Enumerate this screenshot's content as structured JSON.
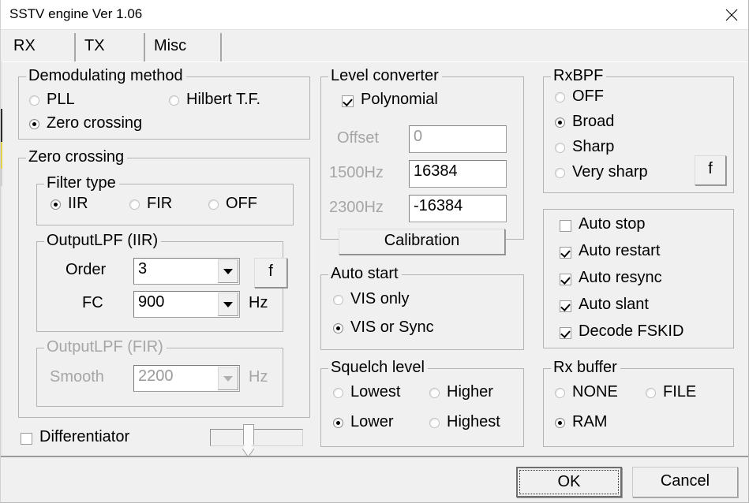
{
  "window": {
    "title": "SSTV engine Ver 1.06",
    "close_icon": "close-icon"
  },
  "tabs": [
    {
      "label": "RX",
      "selected": true
    },
    {
      "label": "TX",
      "selected": false
    },
    {
      "label": "Misc",
      "selected": false
    }
  ],
  "demodulating_method": {
    "legend": "Demodulating method",
    "options": [
      {
        "label": "PLL",
        "selected": false
      },
      {
        "label": "Hilbert T.F.",
        "selected": false
      },
      {
        "label": "Zero crossing",
        "selected": true
      }
    ]
  },
  "zero_crossing": {
    "legend": "Zero crossing",
    "filter_type": {
      "legend": "Filter type",
      "options": [
        {
          "label": "IIR",
          "selected": true
        },
        {
          "label": "FIR",
          "selected": false
        },
        {
          "label": "OFF",
          "selected": false
        }
      ]
    },
    "output_lpf_iir": {
      "legend": "OutputLPF (IIR)",
      "order_label": "Order",
      "order_value": "3",
      "f_button": "f",
      "fc_label": "FC",
      "fc_value": "900",
      "fc_unit": "Hz"
    },
    "output_lpf_fir": {
      "legend": "OutputLPF (FIR)",
      "smooth_label": "Smooth",
      "smooth_value": "2200",
      "smooth_unit": "Hz",
      "enabled": false
    }
  },
  "differentiator": {
    "label": "Differentiator",
    "checked": false,
    "slider_position_percent": 40
  },
  "level_converter": {
    "legend": "Level converter",
    "polynomial_label": "Polynomial",
    "polynomial_checked": true,
    "offset_label": "Offset",
    "offset_value": "0",
    "hz1500_label": "1500Hz",
    "hz1500_value": "16384",
    "hz2300_label": "2300Hz",
    "hz2300_value": "-16384",
    "calibration_label": "Calibration"
  },
  "auto_start": {
    "legend": "Auto start",
    "options": [
      {
        "label": "VIS only",
        "selected": false
      },
      {
        "label": "VIS or Sync",
        "selected": true
      }
    ]
  },
  "squelch_level": {
    "legend": "Squelch level",
    "options": [
      {
        "label": "Lowest",
        "selected": false
      },
      {
        "label": "Higher",
        "selected": false
      },
      {
        "label": "Lower",
        "selected": true
      },
      {
        "label": "Highest",
        "selected": false
      }
    ]
  },
  "rxbpf": {
    "legend": "RxBPF",
    "options": [
      {
        "label": "OFF",
        "selected": false
      },
      {
        "label": "Broad",
        "selected": true
      },
      {
        "label": "Sharp",
        "selected": false
      },
      {
        "label": "Very sharp",
        "selected": false
      }
    ],
    "f_button": "f"
  },
  "auto_options": [
    {
      "label": "Auto stop",
      "checked": false
    },
    {
      "label": "Auto restart",
      "checked": true
    },
    {
      "label": "Auto resync",
      "checked": true
    },
    {
      "label": "Auto slant",
      "checked": true
    },
    {
      "label": "Decode FSKID",
      "checked": true
    }
  ],
  "rx_buffer": {
    "legend": "Rx buffer",
    "options": [
      {
        "label": "NONE",
        "selected": false
      },
      {
        "label": "FILE",
        "selected": false
      },
      {
        "label": "RAM",
        "selected": true
      }
    ]
  },
  "footer": {
    "ok_label": "OK",
    "cancel_label": "Cancel"
  }
}
